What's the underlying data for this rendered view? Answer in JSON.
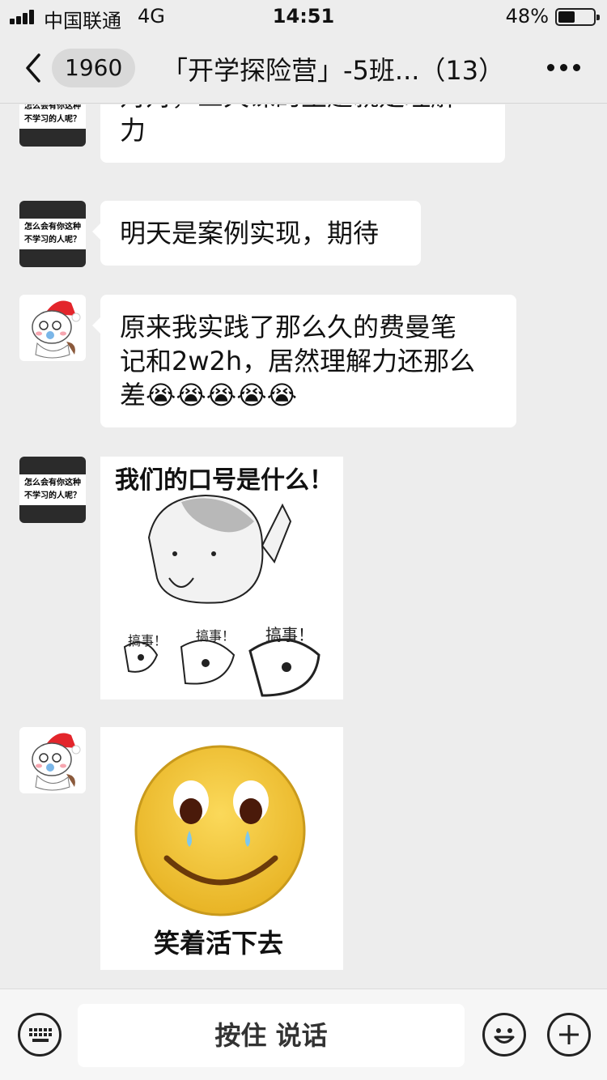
{
  "status_bar": {
    "carrier": "中国联通",
    "network": "4G",
    "time": "14:51",
    "battery_percent": "48%",
    "battery_level": 0.48
  },
  "nav": {
    "back_icon": "chevron-left-icon",
    "unread_count": "1960",
    "title": "「开学探险营」-5班...（13）",
    "more_icon": "ellipsis-icon"
  },
  "avatars": {
    "text_avatar_line1": "怎么会有你这种",
    "text_avatar_line2": "不学习的人呢？"
  },
  "messages": [
    {
      "type": "text",
      "sender": "text-avatar",
      "line1": "对对，三天课的主题就是理解",
      "line2": "力"
    },
    {
      "type": "text",
      "sender": "text-avatar",
      "line1": "明天是案例实现，期待"
    },
    {
      "type": "text",
      "sender": "cartoon-avatar",
      "line1": "原来我实践了那么久的费曼笔",
      "line2": "记和2w2h，居然理解力还那么",
      "line3": "差",
      "emoji": "😭😭😭😭😭"
    },
    {
      "type": "sticker",
      "sender": "text-avatar",
      "caption": "我们的口号是什么！",
      "shout1": "搞事！",
      "shout2": "搞事！",
      "shout3": "搞事！"
    },
    {
      "type": "sticker",
      "sender": "cartoon-avatar",
      "caption": "笑着活下去"
    }
  ],
  "input_bar": {
    "keyboard_icon": "keyboard-icon",
    "talk_label": "按住 说话",
    "emoji_icon": "smiley-icon",
    "plus_icon": "plus-icon"
  },
  "colors": {
    "background": "#ededed",
    "bubble": "#ffffff",
    "emoji_yellow": "#f5c431"
  }
}
